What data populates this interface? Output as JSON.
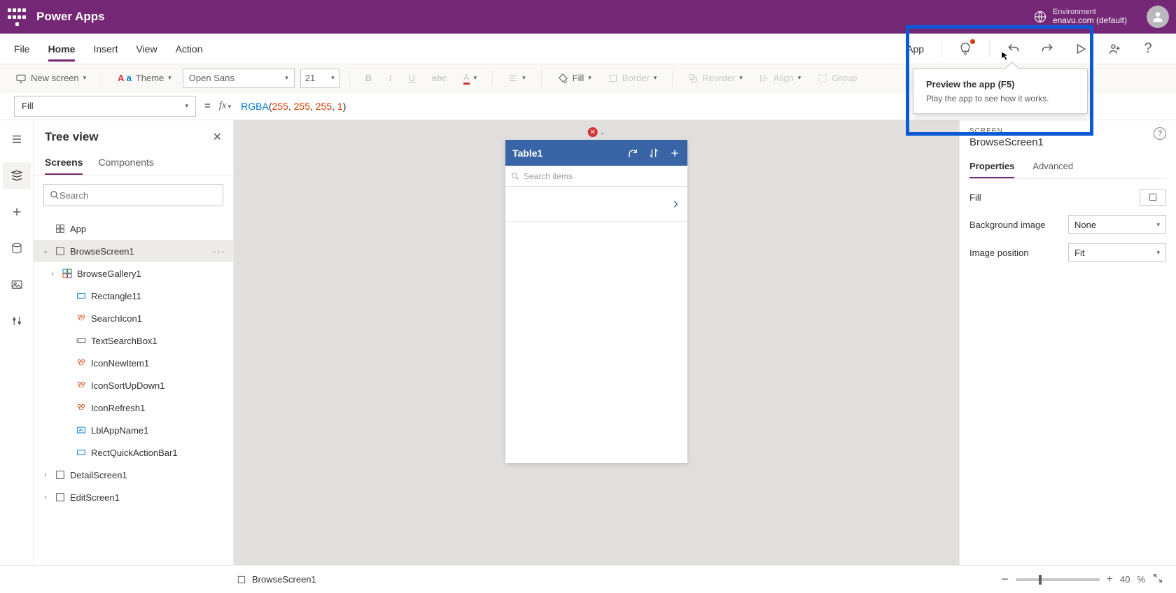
{
  "header": {
    "app_name": "Power Apps",
    "env_label": "Environment",
    "env_value": "enavu.com (default)"
  },
  "menubar": {
    "file": "File",
    "home": "Home",
    "insert": "Insert",
    "view": "View",
    "action": "Action",
    "app": "App"
  },
  "ribbon": {
    "new_screen": "New screen",
    "theme": "Theme",
    "font": "Open Sans",
    "font_size": "21",
    "fill": "Fill",
    "border": "Border",
    "reorder": "Reorder",
    "align": "Align",
    "group": "Group"
  },
  "formula": {
    "property": "Fill",
    "fn": "RGBA",
    "a1": "255",
    "a2": "255",
    "a3": "255",
    "a4": "1"
  },
  "tree": {
    "title": "Tree view",
    "tab_screens": "Screens",
    "tab_components": "Components",
    "search_placeholder": "Search",
    "items": {
      "app": "App",
      "browse": "BrowseScreen1",
      "gallery": "BrowseGallery1",
      "rect": "Rectangle11",
      "searchicon": "SearchIcon1",
      "textsearch": "TextSearchBox1",
      "iconnew": "IconNewItem1",
      "iconsort": "IconSortUpDown1",
      "iconrefresh": "IconRefresh1",
      "lbl": "LblAppName1",
      "rectquick": "RectQuickActionBar1",
      "detail": "DetailScreen1",
      "edit": "EditScreen1"
    }
  },
  "canvas": {
    "table_title": "Table1",
    "search_placeholder": "Search items"
  },
  "tooltip": {
    "title": "Preview the app (F5)",
    "body": "Play the app to see how it works."
  },
  "props": {
    "section": "SCREEN",
    "name": "BrowseScreen1",
    "tab_props": "Properties",
    "tab_adv": "Advanced",
    "fill_label": "Fill",
    "bg_label": "Background image",
    "bg_value": "None",
    "pos_label": "Image position",
    "pos_value": "Fit"
  },
  "statusbar": {
    "name": "BrowseScreen1",
    "zoom": "40",
    "pct": "%"
  }
}
